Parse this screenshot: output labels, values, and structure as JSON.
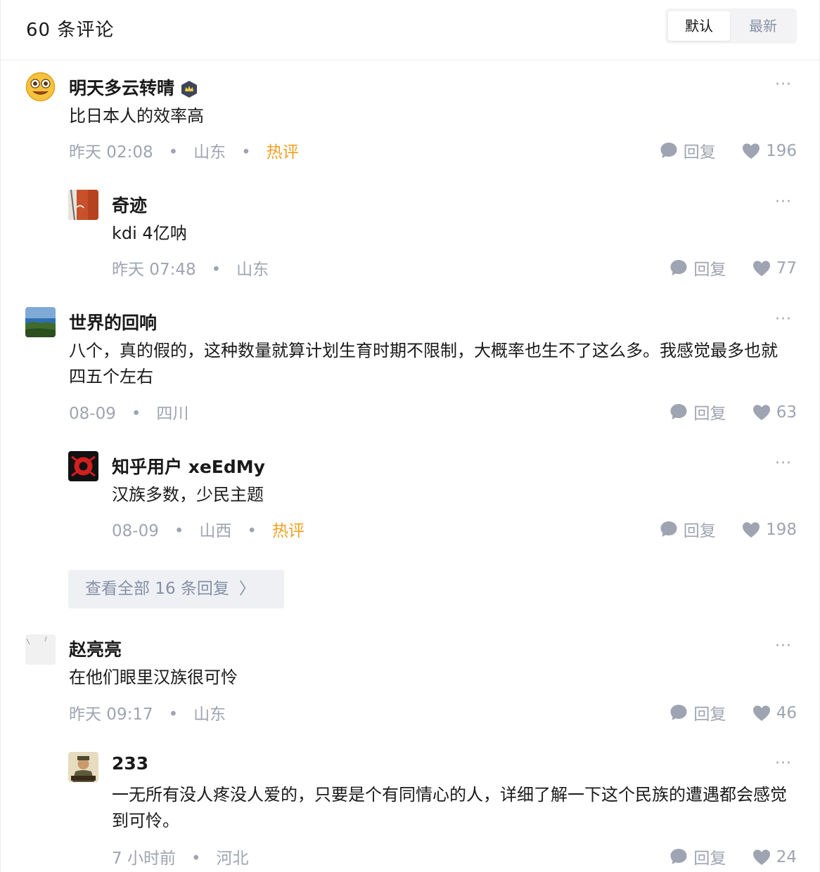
{
  "header": {
    "count_label": "60  条评论",
    "sort_default": "默认",
    "sort_newest": "最新"
  },
  "comments": [
    {
      "author": "明天多云转晴",
      "content": "比日本人的效率高",
      "time": "昨天  02:08",
      "location": "山东",
      "tag": "热评",
      "reply": "回复",
      "likes": "196"
    },
    {
      "author": "奇迹",
      "content": "kdi  4亿呐",
      "time": "昨天  07:48",
      "location": "山东",
      "reply": "回复",
      "likes": "77"
    },
    {
      "author": "世界的回响",
      "content": "八个，真的假的，这种数量就算计划生育时期不限制，大概率也生不了这么多。我感觉最多也就四五个左右",
      "time": "08-09",
      "location": "四川",
      "reply": "回复",
      "likes": "63"
    },
    {
      "author": "知乎用户 xeEdMy",
      "content": "汉族多数，少民主题",
      "time": "08-09",
      "location": "山西",
      "tag": "热评",
      "reply": "回复",
      "likes": "198"
    },
    {
      "author": "赵亮亮",
      "content": "在他们眼里汉族很可怜",
      "time": "昨天  09:17",
      "location": "山东",
      "reply": "回复",
      "likes": "46"
    },
    {
      "author": "233",
      "content": "一无所有没人疼没人爱的，只要是个有同情心的人，详细了解一下这个民族的遭遇都会感觉到可怜。",
      "time": "7  小时前",
      "location": "河北",
      "reply": "回复",
      "likes": "24"
    }
  ],
  "view_all": {
    "label": "查看全部  16  条回复",
    "chevron": "〉"
  },
  "more_glyph": "···",
  "meta_dot": "•",
  "icons": {
    "reply": "comment-bubble-icon",
    "like": "heart-icon",
    "badge": "crown-badge-icon"
  },
  "colors": {
    "meta": "#9ea4b1",
    "hot": "#f0a020",
    "accent_gray": "#8590a6"
  }
}
